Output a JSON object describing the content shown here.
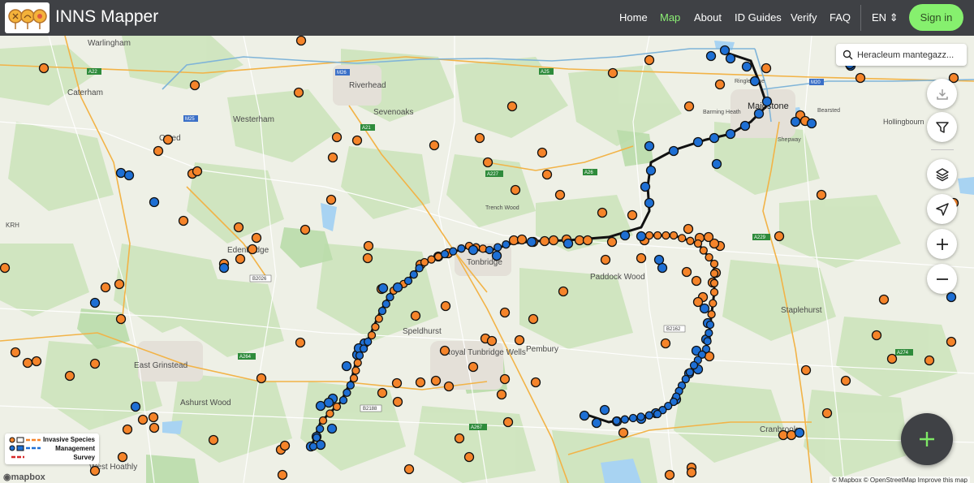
{
  "header": {
    "app_title": "INNS Mapper",
    "nav": [
      {
        "label": "Home",
        "active": false
      },
      {
        "label": "Map",
        "active": true
      },
      {
        "label": "About",
        "active": false
      },
      {
        "label": "ID Guides",
        "active": false
      },
      {
        "label": "Verify",
        "active": false
      },
      {
        "label": "FAQ",
        "active": false
      }
    ],
    "language": "EN",
    "signin_label": "Sign in"
  },
  "search": {
    "value": "Heracleum mantegazz..."
  },
  "legend": {
    "items": [
      "Invasive Species",
      "Management",
      "Survey"
    ]
  },
  "colors": {
    "survey_orange": "#f5842a",
    "management_blue": "#1e6fd4",
    "accent_green": "#86f06e",
    "topbar": "#3f4145"
  },
  "map_places": [
    "Warlingham",
    "Caterham",
    "Westerham",
    "Riverhead",
    "Sevenoaks",
    "Oxted",
    "Edenbridge",
    "East Grinstead",
    "Ashurst Wood",
    "West Hoathly",
    "Speldhurst",
    "Tonbridge",
    "Royal Tunbridge Wells",
    "Pembury",
    "Paddock Wood",
    "Maidstone",
    "Barming Heath",
    "Staplehurst",
    "Cranbrook",
    "Hollingbourn",
    "Bearsted",
    "Shepway",
    "Ringlestone",
    "Trench Wood",
    "KRH"
  ],
  "road_labels": [
    "A22",
    "M25",
    "M26",
    "A25",
    "A21",
    "A227",
    "A26",
    "A229",
    "M20",
    "A264",
    "A274",
    "A267",
    "B2026",
    "B2162",
    "B2188"
  ],
  "attribution": {
    "mapbox_logo": "mapbox",
    "credits": "© Mapbox © OpenStreetMap Improve this map"
  }
}
